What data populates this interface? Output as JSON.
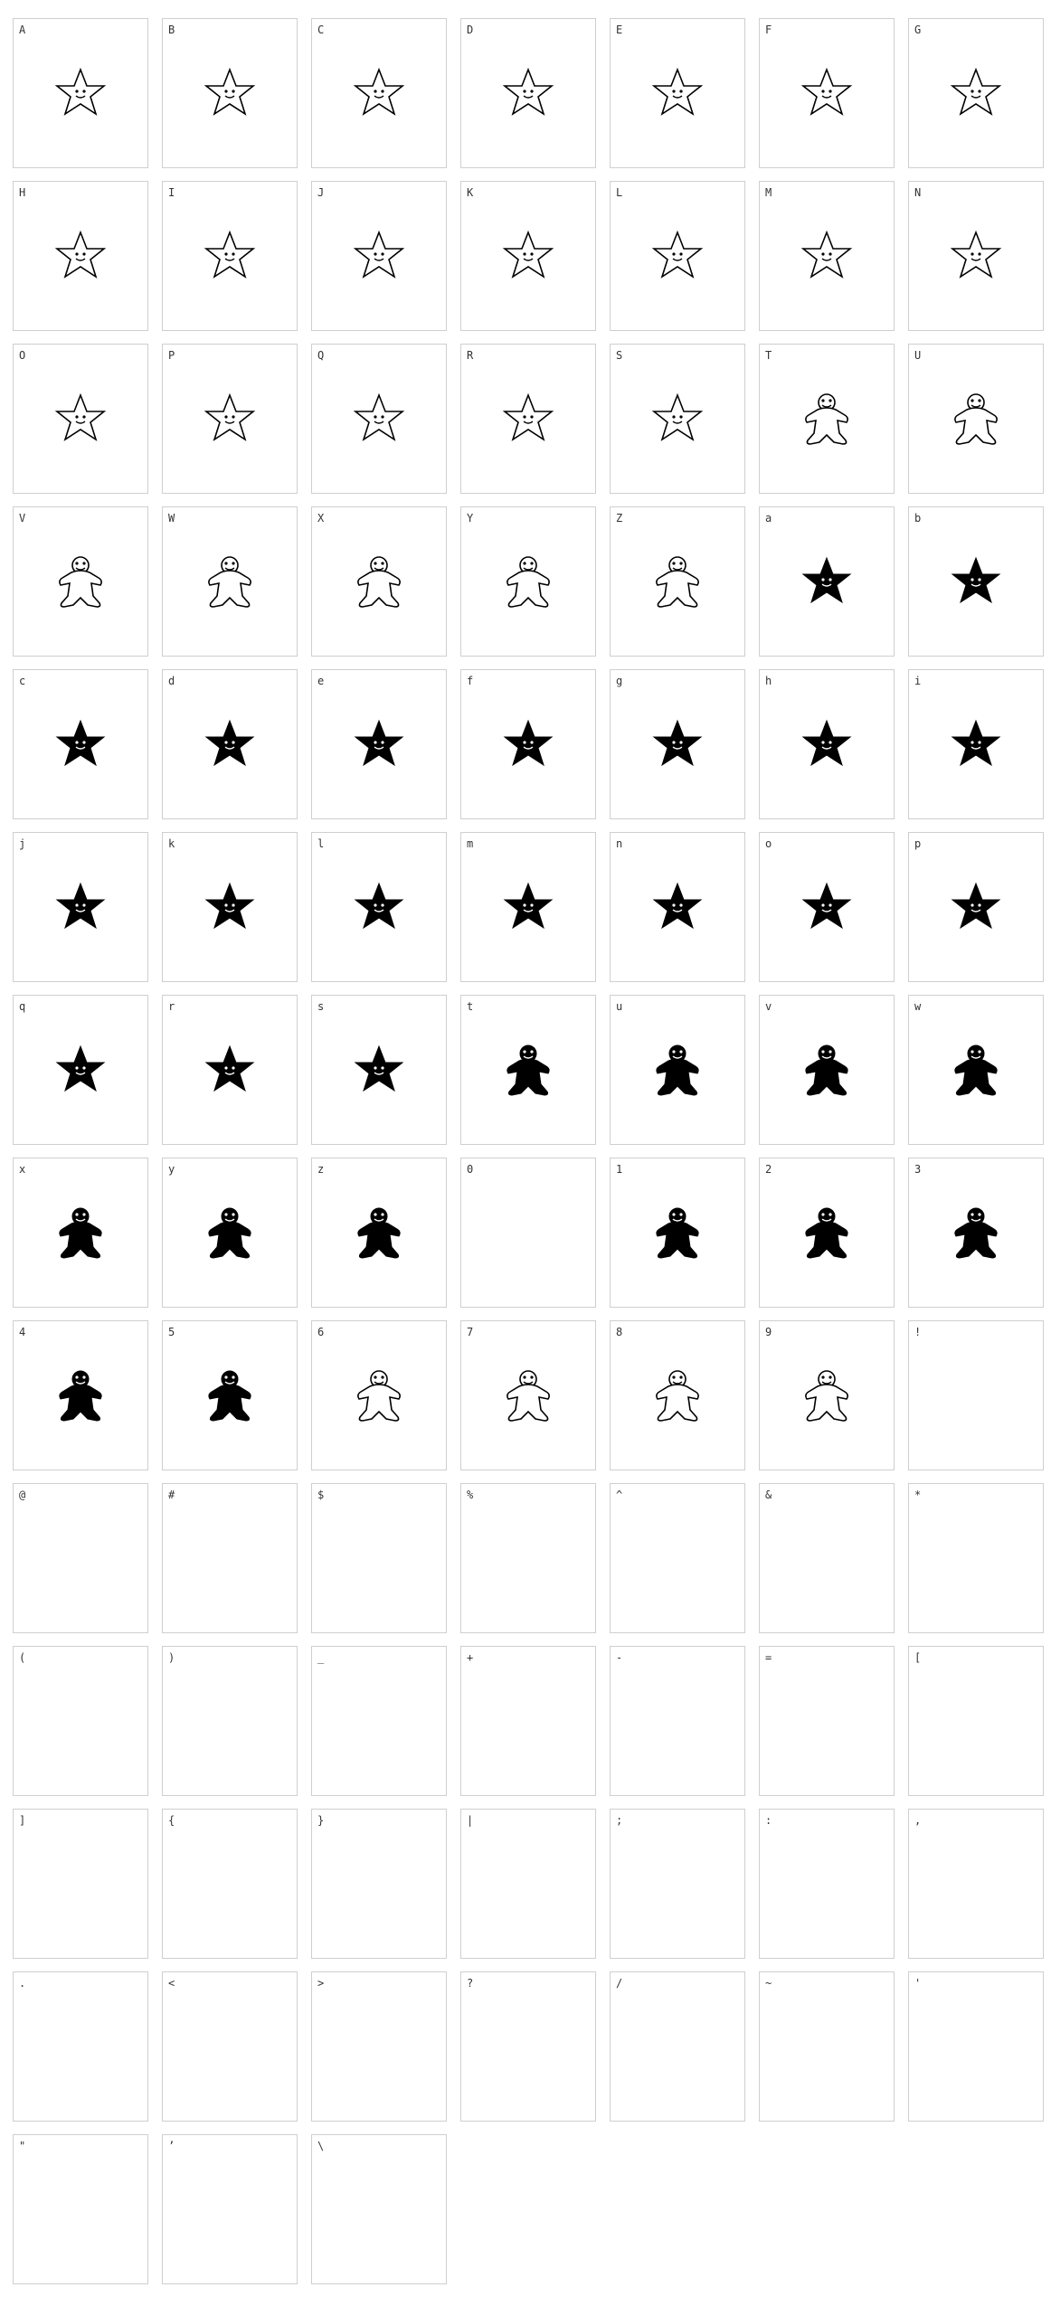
{
  "colors": {
    "border": "#cfcfcf",
    "label": "#333333",
    "glyph_ink": "#000000",
    "background": "#ffffff"
  },
  "cells": [
    {
      "label": "A",
      "glyph": "star-outline-icon"
    },
    {
      "label": "B",
      "glyph": "star-outline-icon"
    },
    {
      "label": "C",
      "glyph": "star-outline-icon"
    },
    {
      "label": "D",
      "glyph": "star-outline-icon"
    },
    {
      "label": "E",
      "glyph": "star-outline-icon"
    },
    {
      "label": "F",
      "glyph": "star-outline-icon"
    },
    {
      "label": "G",
      "glyph": "star-outline-icon"
    },
    {
      "label": "H",
      "glyph": "star-outline-icon"
    },
    {
      "label": "I",
      "glyph": "star-outline-icon"
    },
    {
      "label": "J",
      "glyph": "star-outline-icon"
    },
    {
      "label": "K",
      "glyph": "star-outline-icon"
    },
    {
      "label": "L",
      "glyph": "star-outline-icon"
    },
    {
      "label": "M",
      "glyph": "star-outline-icon"
    },
    {
      "label": "N",
      "glyph": "star-outline-icon"
    },
    {
      "label": "O",
      "glyph": "star-outline-icon"
    },
    {
      "label": "P",
      "glyph": "star-outline-icon"
    },
    {
      "label": "Q",
      "glyph": "star-outline-icon"
    },
    {
      "label": "R",
      "glyph": "star-outline-icon"
    },
    {
      "label": "S",
      "glyph": "star-outline-icon"
    },
    {
      "label": "T",
      "glyph": "gingerbread-outline-icon"
    },
    {
      "label": "U",
      "glyph": "gingerbread-outline-icon"
    },
    {
      "label": "V",
      "glyph": "gingerbread-outline-icon"
    },
    {
      "label": "W",
      "glyph": "gingerbread-outline-icon"
    },
    {
      "label": "X",
      "glyph": "gingerbread-outline-icon"
    },
    {
      "label": "Y",
      "glyph": "gingerbread-outline-icon"
    },
    {
      "label": "Z",
      "glyph": "gingerbread-outline-icon"
    },
    {
      "label": "a",
      "glyph": "star-filled-icon"
    },
    {
      "label": "b",
      "glyph": "star-filled-icon"
    },
    {
      "label": "c",
      "glyph": "star-filled-icon"
    },
    {
      "label": "d",
      "glyph": "star-filled-icon"
    },
    {
      "label": "e",
      "glyph": "star-filled-icon"
    },
    {
      "label": "f",
      "glyph": "star-filled-icon"
    },
    {
      "label": "g",
      "glyph": "star-filled-icon"
    },
    {
      "label": "h",
      "glyph": "star-filled-icon"
    },
    {
      "label": "i",
      "glyph": "star-filled-icon"
    },
    {
      "label": "j",
      "glyph": "star-filled-icon"
    },
    {
      "label": "k",
      "glyph": "star-filled-icon"
    },
    {
      "label": "l",
      "glyph": "star-filled-icon"
    },
    {
      "label": "m",
      "glyph": "star-filled-icon"
    },
    {
      "label": "n",
      "glyph": "star-filled-icon"
    },
    {
      "label": "o",
      "glyph": "star-filled-icon"
    },
    {
      "label": "p",
      "glyph": "star-filled-icon"
    },
    {
      "label": "q",
      "glyph": "star-filled-icon"
    },
    {
      "label": "r",
      "glyph": "star-filled-icon"
    },
    {
      "label": "s",
      "glyph": "star-filled-icon"
    },
    {
      "label": "t",
      "glyph": "gingerbread-filled-icon"
    },
    {
      "label": "u",
      "glyph": "gingerbread-filled-icon"
    },
    {
      "label": "v",
      "glyph": "gingerbread-filled-icon"
    },
    {
      "label": "w",
      "glyph": "gingerbread-filled-icon"
    },
    {
      "label": "x",
      "glyph": "gingerbread-filled-icon"
    },
    {
      "label": "y",
      "glyph": "gingerbread-filled-icon"
    },
    {
      "label": "z",
      "glyph": "gingerbread-filled-icon"
    },
    {
      "label": "0",
      "glyph": ""
    },
    {
      "label": "1",
      "glyph": "gingerbread-filled-icon"
    },
    {
      "label": "2",
      "glyph": "gingerbread-filled-icon"
    },
    {
      "label": "3",
      "glyph": "gingerbread-filled-icon"
    },
    {
      "label": "4",
      "glyph": "gingerbread-filled-icon"
    },
    {
      "label": "5",
      "glyph": "gingerbread-filled-icon"
    },
    {
      "label": "6",
      "glyph": "gingerbread-outline-icon"
    },
    {
      "label": "7",
      "glyph": "gingerbread-outline-icon"
    },
    {
      "label": "8",
      "glyph": "gingerbread-outline-icon"
    },
    {
      "label": "9",
      "glyph": "gingerbread-outline-icon"
    },
    {
      "label": "!",
      "glyph": ""
    },
    {
      "label": "@",
      "glyph": ""
    },
    {
      "label": "#",
      "glyph": ""
    },
    {
      "label": "$",
      "glyph": ""
    },
    {
      "label": "%",
      "glyph": ""
    },
    {
      "label": "^",
      "glyph": ""
    },
    {
      "label": "&",
      "glyph": ""
    },
    {
      "label": "*",
      "glyph": ""
    },
    {
      "label": "(",
      "glyph": ""
    },
    {
      "label": ")",
      "glyph": ""
    },
    {
      "label": "_",
      "glyph": ""
    },
    {
      "label": "+",
      "glyph": ""
    },
    {
      "label": "-",
      "glyph": ""
    },
    {
      "label": "=",
      "glyph": ""
    },
    {
      "label": "[",
      "glyph": ""
    },
    {
      "label": "]",
      "glyph": ""
    },
    {
      "label": "{",
      "glyph": ""
    },
    {
      "label": "}",
      "glyph": ""
    },
    {
      "label": "|",
      "glyph": ""
    },
    {
      "label": ";",
      "glyph": ""
    },
    {
      "label": ":",
      "glyph": ""
    },
    {
      "label": ",",
      "glyph": ""
    },
    {
      "label": ".",
      "glyph": ""
    },
    {
      "label": "<",
      "glyph": ""
    },
    {
      "label": ">",
      "glyph": ""
    },
    {
      "label": "?",
      "glyph": ""
    },
    {
      "label": "/",
      "glyph": ""
    },
    {
      "label": "~",
      "glyph": ""
    },
    {
      "label": "'",
      "glyph": ""
    },
    {
      "label": "\"",
      "glyph": ""
    },
    {
      "label": "’",
      "glyph": ""
    },
    {
      "label": "\\",
      "glyph": ""
    }
  ]
}
